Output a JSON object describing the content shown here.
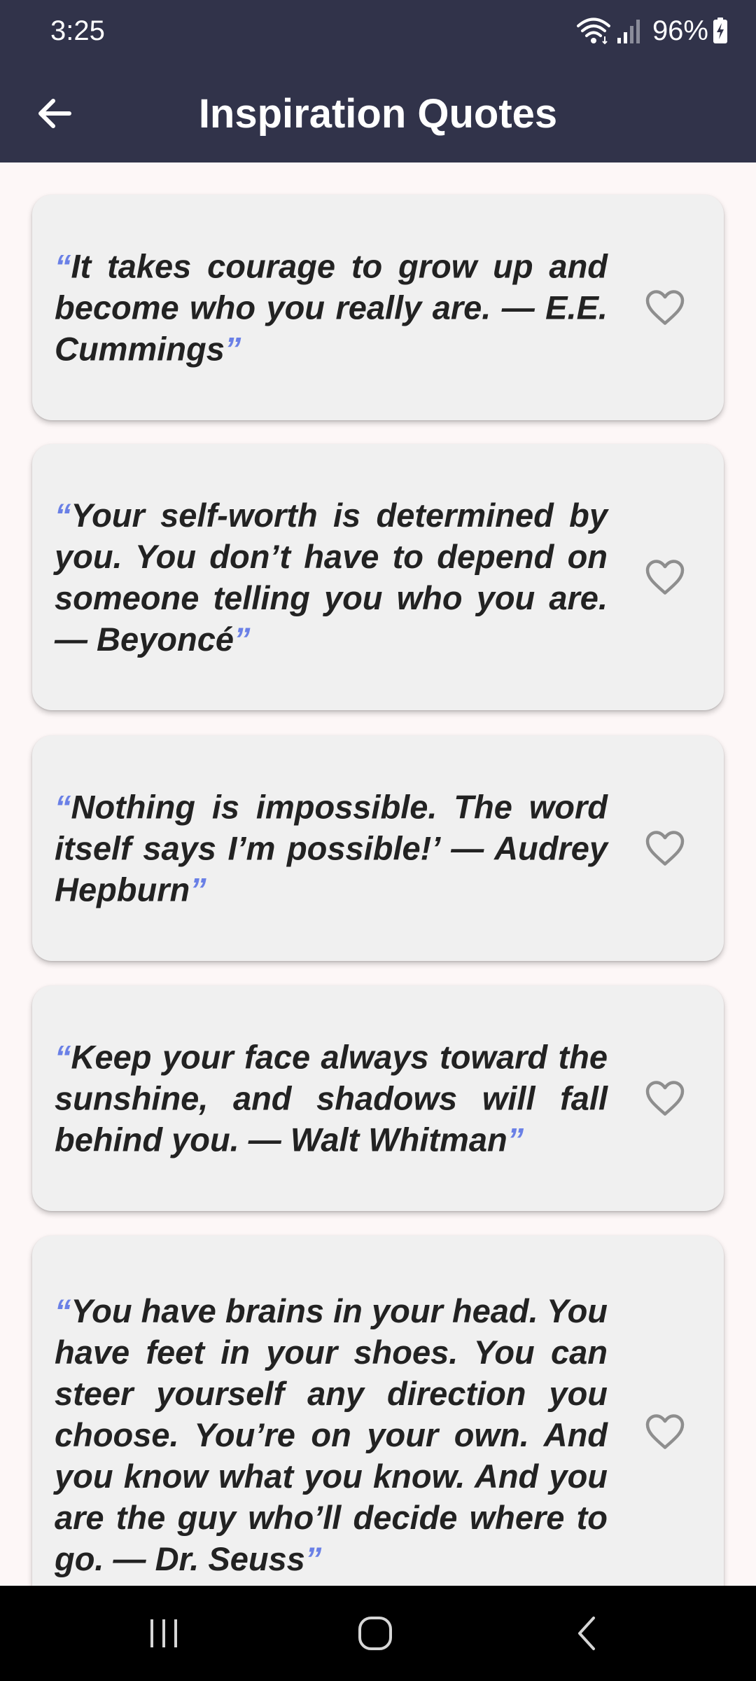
{
  "status_bar": {
    "time": "3:25",
    "battery": "96%",
    "icons": [
      "wifi-icon",
      "signal-icon",
      "battery-charging-icon"
    ]
  },
  "app_bar": {
    "title": "Inspiration Quotes",
    "back_icon": "arrow-left-icon"
  },
  "colors": {
    "app_bar_bg": "#31334a",
    "page_bg": "#fdf7f7",
    "card_bg": "#f0f0f0",
    "quote_mark": "#6a80e6",
    "heart": "#8e8e8e"
  },
  "quotes": [
    {
      "text": "It takes courage to grow up and become who you really are. — E.E. Cummings",
      "open_mark": "“",
      "close_mark": "”",
      "favorited": false
    },
    {
      "text": "Your self-worth is determined by you. You don’t have to depend on someone telling you who you are. — Beyoncé",
      "open_mark": "“",
      "close_mark": "”",
      "favorited": false
    },
    {
      "text": "Nothing is impossible. The word itself says I’m possible!’ — Audrey Hepburn",
      "open_mark": "“",
      "close_mark": "”",
      "favorited": false
    },
    {
      "text": "Keep your face always toward the sunshine, and shadows will fall behind you. — Walt Whitman",
      "open_mark": "“",
      "close_mark": "”",
      "favorited": false
    },
    {
      "text": "You have brains in your head. You have feet in your shoes. You can steer yourself any direction you choose. You’re on your own. And you know what you know. And you are the guy who’ll decide where to go. — Dr. Seuss",
      "open_mark": "“",
      "close_mark": "”",
      "favorited": false
    }
  ],
  "nav_bar": {
    "buttons": [
      "recent-apps-icon",
      "home-icon",
      "back-icon"
    ]
  }
}
